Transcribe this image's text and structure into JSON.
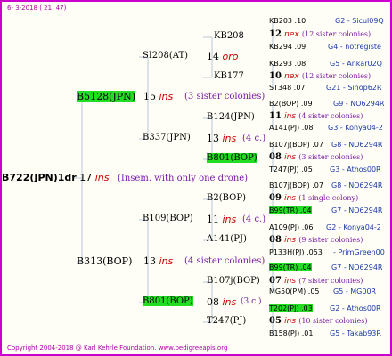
{
  "header": {
    "date": "6- 3-2018 ( 21: 47)"
  },
  "footer": {
    "copyright": "Copyright 2004-2018 @ Karl Kehrle Foundation.   www.pedigreeapis.org"
  },
  "root": {
    "name": "B722(JPN)1dr",
    "num": "17",
    "ins": "ins",
    "note": "(Insem. with only one drone)"
  },
  "n_B5128": {
    "name": "B5128(JPN)",
    "num": "15",
    "ins": "ins",
    "note": "(3 sister colonies)"
  },
  "n_B313": {
    "name": "B313(BOP)",
    "num": "13",
    "ins": "ins",
    "note": "(4 sister colonies)"
  },
  "n_SI208": {
    "name": "SI208(AT)",
    "num": "14",
    "ins": "oro"
  },
  "n_B337": {
    "name": "B337(JPN)",
    "num": "13",
    "ins": "ins",
    "note": "(4 c.)"
  },
  "n_B109": {
    "name": "B109(BOP)",
    "num": "11",
    "ins": "ins",
    "note": "(4 c.)"
  },
  "n_B801b": {
    "name": "B801(BOP)",
    "num": "08",
    "ins": "ins",
    "note": "(3 c.)"
  },
  "n_KB208": {
    "name": "KB208"
  },
  "n_KB177": {
    "name": "KB177"
  },
  "n_B124": {
    "name": "B124(JPN)"
  },
  "n_B801a": {
    "name": "B801(BOP)"
  },
  "n_B2": {
    "name": "B2(BOP)"
  },
  "n_A141": {
    "name": "A141(PJ)"
  },
  "n_B107": {
    "name": "B107j(BOP)"
  },
  "n_T247": {
    "name": "T247(PJ)"
  },
  "g1": {
    "a": "KB203 .10",
    "a2": "G2 - Sicul09Q",
    "num": "12",
    "ins": "nex",
    "note": "(12 sister colonies)",
    "b": "KB294 .09",
    "b2": "G4 - notregiste"
  },
  "g2": {
    "a": "KB293 .08",
    "a2": "G5 - Ankar02Q",
    "num": "10",
    "ins": "nex",
    "note": "(12 sister colonies)",
    "b": "ST348 .07",
    "b2": "G21 - Sinop62R"
  },
  "g3": {
    "a": "B2(BOP) .09",
    "a2": "G9 - NO6294R",
    "num": "11",
    "ins": "ins",
    "note": "(4 sister colonies)",
    "b": "A141(PJ) .08",
    "b2": "G3 - Konya04-2"
  },
  "g4": {
    "a": "B107j(BOP) .07",
    "a2": "G8 - NO6294R",
    "num": "08",
    "ins": "ins",
    "note": "(3 sister colonies)",
    "b": "T247(PJ) .05",
    "b2": "G3 - Athos00R"
  },
  "g5": {
    "a": "B107j(BOP) .07",
    "a2": "G8 - NO6294R",
    "num": "09",
    "ins": "ins",
    "note": "(1 single colony)",
    "b": "B99(TR) .04",
    "b2": "G7 - NO6294R"
  },
  "g6": {
    "a": "A109(PJ) .06",
    "a2": "G2 - Konya04-2",
    "num": "08",
    "ins": "ins",
    "note": "(9 sister colonies)",
    "b": "P133H(PJ) .053",
    "b2": "- PrimGreen00"
  },
  "g7": {
    "a": "B99(TR) .04",
    "a2": "G7 - NO6294R",
    "num": "07",
    "ins": "ins",
    "note": "(7 sister colonies)",
    "b": "MG50(PM) .05",
    "b2": "G5 - MG00R"
  },
  "g8": {
    "a": "T202(PJ) .03",
    "a2": "G2 - Athos00R",
    "num": "05",
    "ins": "ins",
    "note": "(10 sister colonies)",
    "b": "B158(PJ) .01",
    "b2": "G5 - Takab93R"
  },
  "colors": {
    "border": "#cc00cc",
    "highlight": "#22dd22",
    "ins": "#cc0000",
    "note": "#7a1aa8",
    "gen": "#1a3aaa",
    "lines": "#b8c8d8"
  }
}
